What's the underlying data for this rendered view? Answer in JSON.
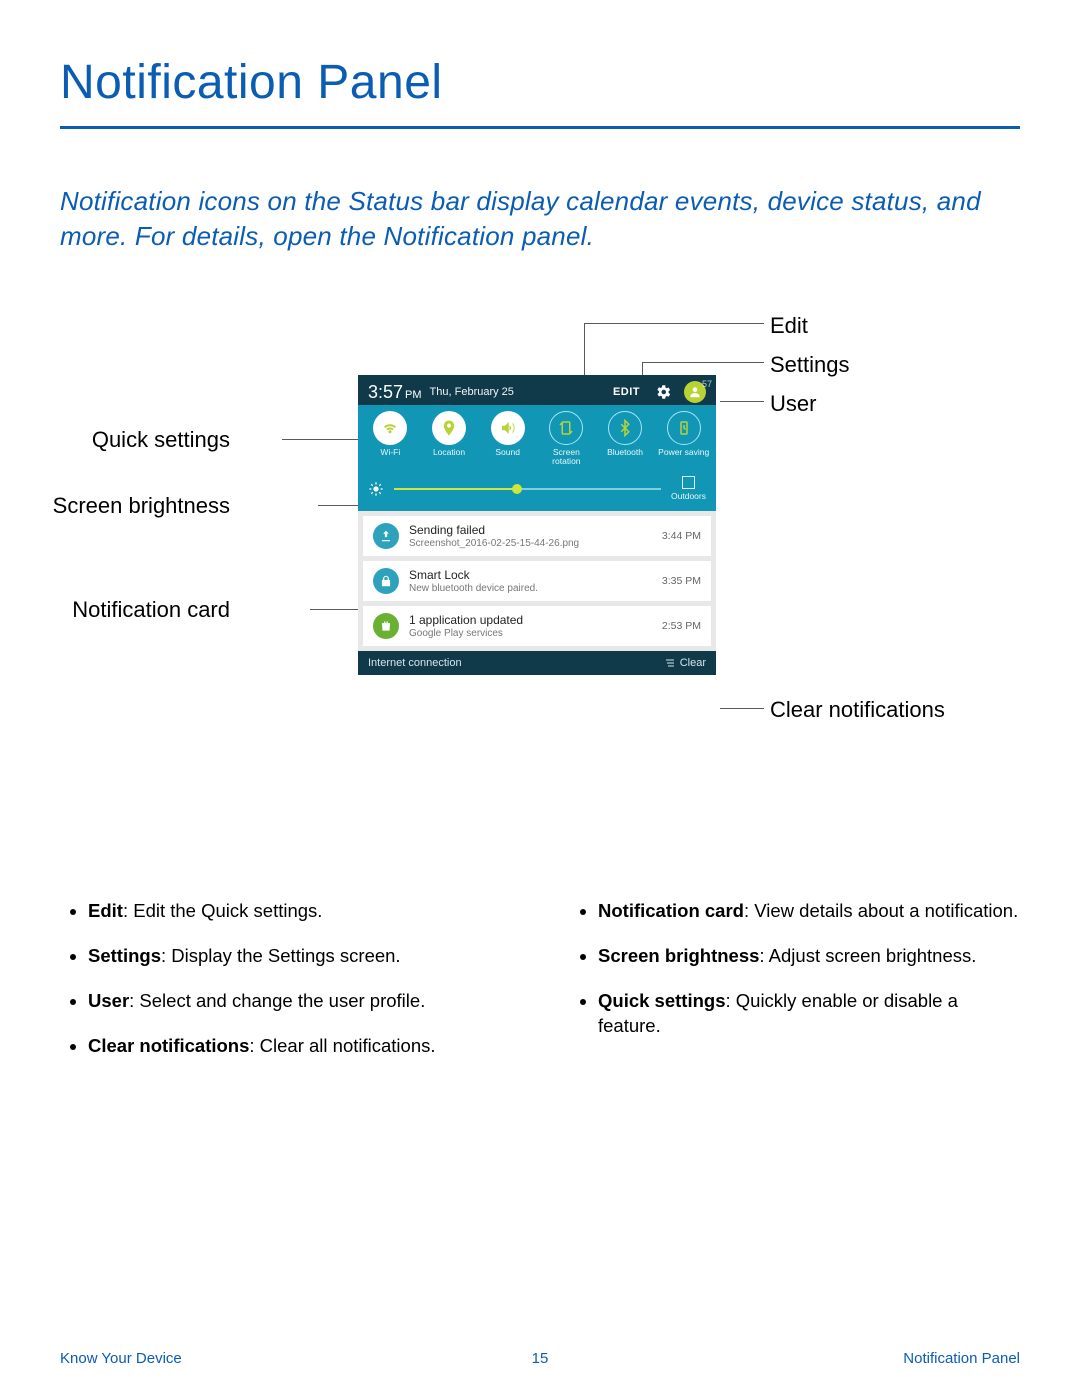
{
  "page": {
    "title": "Notification Panel",
    "intro": "Notification icons on the Status bar display calendar events, device status, and more. For details, open the Notification panel.",
    "footer_left": "Know Your Device",
    "footer_page": "15",
    "footer_right": "Notification Panel"
  },
  "callouts": {
    "edit": "Edit",
    "settings": "Settings",
    "user": "User",
    "quick_settings": "Quick settings",
    "screen_brightness": "Screen brightness",
    "notification_card": "Notification card",
    "clear_notifications": "Clear notifications"
  },
  "phone": {
    "time": "3:57",
    "ampm": "PM",
    "date": "Thu, February 25",
    "edit": "EDIT",
    "battery_badge": "57",
    "qs": [
      {
        "label": "Wi-Fi",
        "icon": "wifi"
      },
      {
        "label": "Location",
        "icon": "location"
      },
      {
        "label": "Sound",
        "icon": "sound"
      },
      {
        "label": "Screen rotation",
        "icon": "rotation"
      },
      {
        "label": "Bluetooth",
        "icon": "bluetooth"
      },
      {
        "label": "Power saving",
        "icon": "power"
      }
    ],
    "outdoors": "Outdoors",
    "cards": [
      {
        "title": "Sending failed",
        "sub": "Screenshot_2016-02-25-15-44-26.png",
        "time": "3:44 PM",
        "icon": "upload",
        "color": "#2ea1bd"
      },
      {
        "title": "Smart Lock",
        "sub": "New bluetooth device paired.",
        "time": "3:35 PM",
        "icon": "lock",
        "color": "#2ea1bd"
      },
      {
        "title": "1 application updated",
        "sub": "Google Play services",
        "time": "2:53 PM",
        "icon": "bag",
        "color": "#6ab133"
      }
    ],
    "footer_left": "Internet connection",
    "clear": "Clear"
  },
  "bullets_left": [
    {
      "b": "Edit",
      "t": ": Edit the Quick settings."
    },
    {
      "b": "Settings",
      "t": ": Display the Settings screen."
    },
    {
      "b": "User",
      "t": ": Select and change the user profile."
    },
    {
      "b": "Clear notifications",
      "t": ": Clear all notifications."
    }
  ],
  "bullets_right": [
    {
      "b": "Notification card",
      "t": ": View details about a notification."
    },
    {
      "b": "Screen brightness",
      "t": ": Adjust screen brightness."
    },
    {
      "b": "Quick settings",
      "t": ": Quickly enable or disable a feature."
    }
  ]
}
